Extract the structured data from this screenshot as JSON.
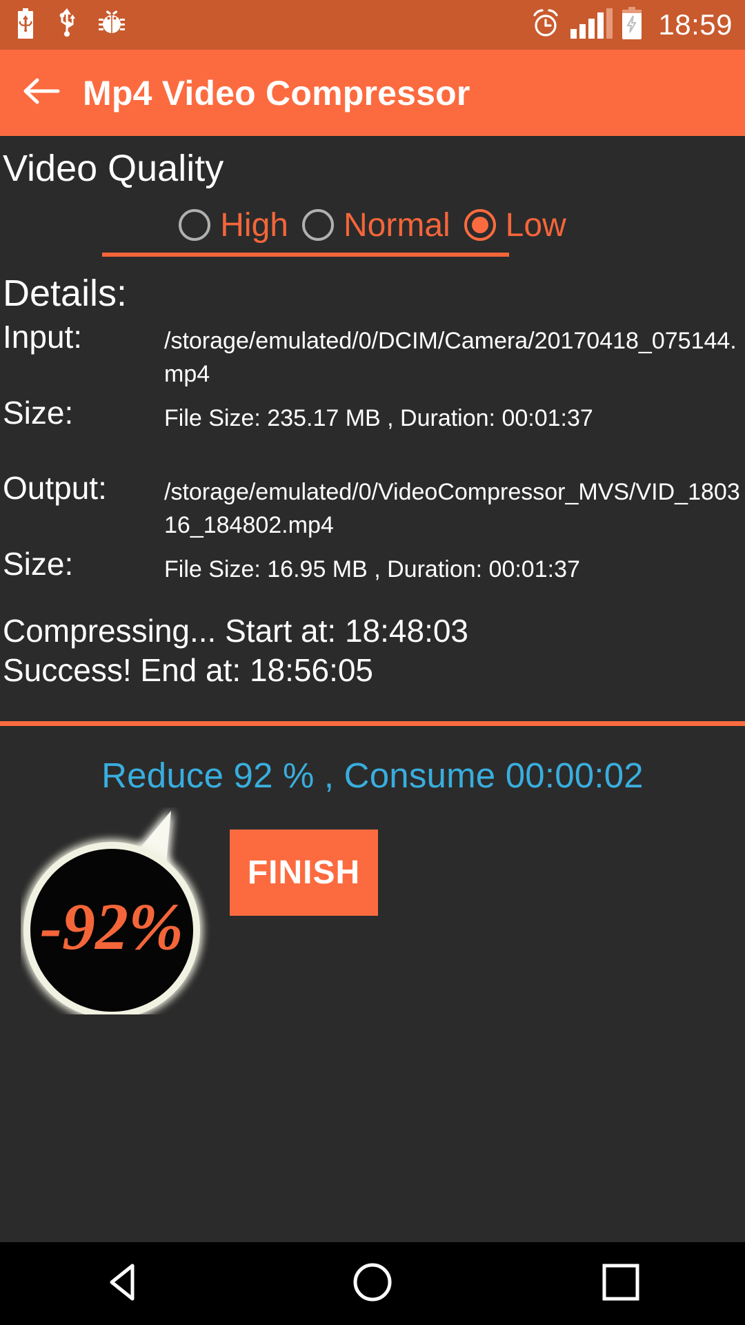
{
  "status_bar": {
    "icons_left": [
      "usb-battery-icon",
      "usb-icon",
      "debug-bug-icon"
    ],
    "icons_right": [
      "alarm-clock-icon",
      "signal-bars-icon",
      "charging-battery-icon"
    ],
    "time": "18:59"
  },
  "app_bar": {
    "back_icon": "back-arrow-icon",
    "title": "Mp4 Video Compressor"
  },
  "quality": {
    "heading": "Video Quality",
    "options": [
      {
        "label": "High",
        "selected": false
      },
      {
        "label": "Normal",
        "selected": false
      },
      {
        "label": "Low",
        "selected": true
      }
    ],
    "selected": "Low"
  },
  "details": {
    "heading": "Details:",
    "input_key": "Input:",
    "input_value": "/storage/emulated/0/DCIM/Camera/20170418_075144.mp4",
    "input_size_key": "Size:",
    "input_size_value": "File Size: 235.17 MB , Duration: 00:01:37",
    "output_key": "Output:",
    "output_value": "/storage/emulated/0/VideoCompressor_MVS/VID_180316_184802.mp4",
    "output_size_key": "Size:",
    "output_size_value": "File Size: 16.95 MB , Duration: 00:01:37"
  },
  "status": {
    "line1": "Compressing... Start at: 18:48:03",
    "line2": "Success! End at: 18:56:05"
  },
  "result": {
    "summary": "Reduce 92 % , Consume 00:00:02",
    "badge_text": "-92%",
    "finish_label": "FINISH"
  },
  "nav_bar": {
    "back": "nav-back-icon",
    "home": "nav-home-icon",
    "recents": "nav-recents-icon"
  },
  "colors": {
    "accent": "#fc6b3f",
    "status_bar": "#c85a2e",
    "background": "#2b2b2b",
    "info_blue": "#39aede",
    "radio_off": "#b0b0b0",
    "text": "#ffffff"
  }
}
